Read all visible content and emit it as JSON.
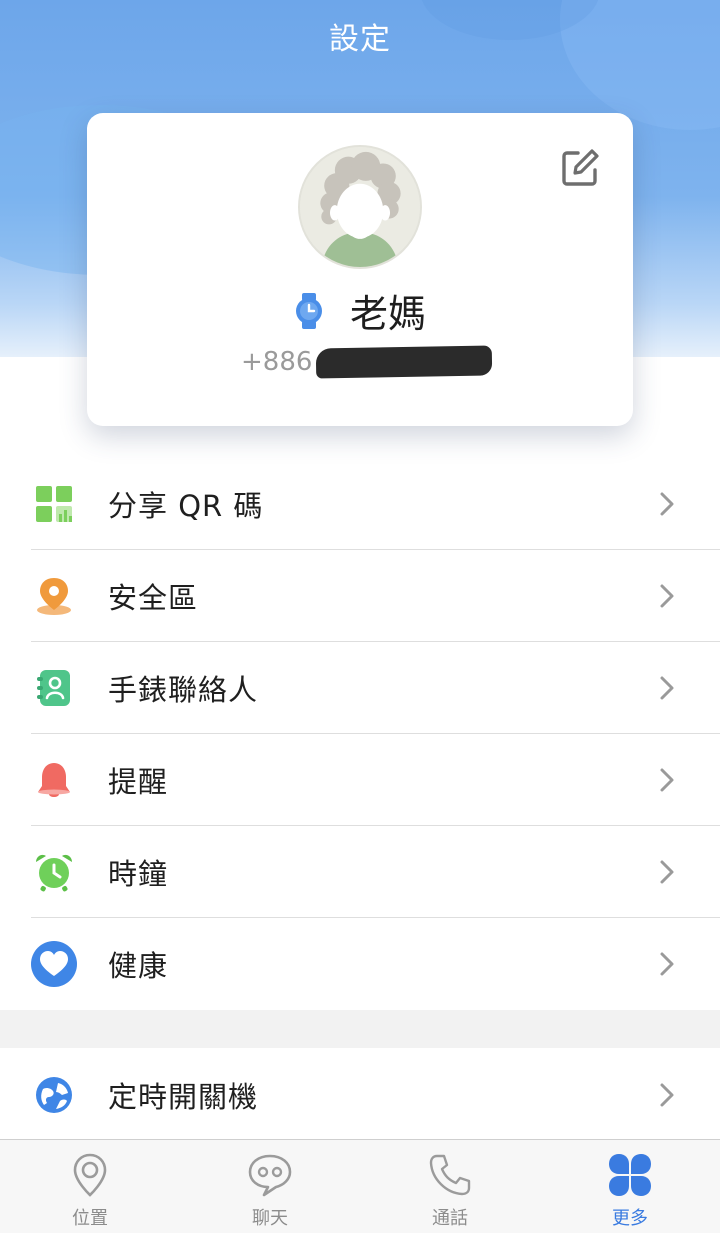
{
  "header": {
    "title": "設定"
  },
  "profile": {
    "name": "老媽",
    "phone_prefix": "+886",
    "edit_icon": "edit-icon",
    "device_icon": "watch-icon"
  },
  "menu": [
    {
      "label": "分享 QR 碼",
      "icon": "qr-code-icon",
      "color": "#7ccf5c"
    },
    {
      "label": "安全區",
      "icon": "location-pin-icon",
      "color": "#f0a040"
    },
    {
      "label": "手錶聯絡人",
      "icon": "contacts-book-icon",
      "color": "#4fc58a"
    },
    {
      "label": "提醒",
      "icon": "bell-icon",
      "color": "#f06a62"
    },
    {
      "label": "時鐘",
      "icon": "alarm-clock-icon",
      "color": "#6fd05a"
    },
    {
      "label": "健康",
      "icon": "heart-icon",
      "color": "#3f86e6"
    }
  ],
  "menu2": [
    {
      "label": "定時開關機",
      "icon": "power-schedule-icon",
      "color": "#3f86e6"
    }
  ],
  "tabbar": {
    "tabs": [
      {
        "label": "位置",
        "icon": "location-icon",
        "active": false
      },
      {
        "label": "聊天",
        "icon": "chat-icon",
        "active": false
      },
      {
        "label": "通話",
        "icon": "phone-icon",
        "active": false
      },
      {
        "label": "更多",
        "icon": "more-clover-icon",
        "active": true
      }
    ],
    "active_color": "#3a7be0"
  }
}
